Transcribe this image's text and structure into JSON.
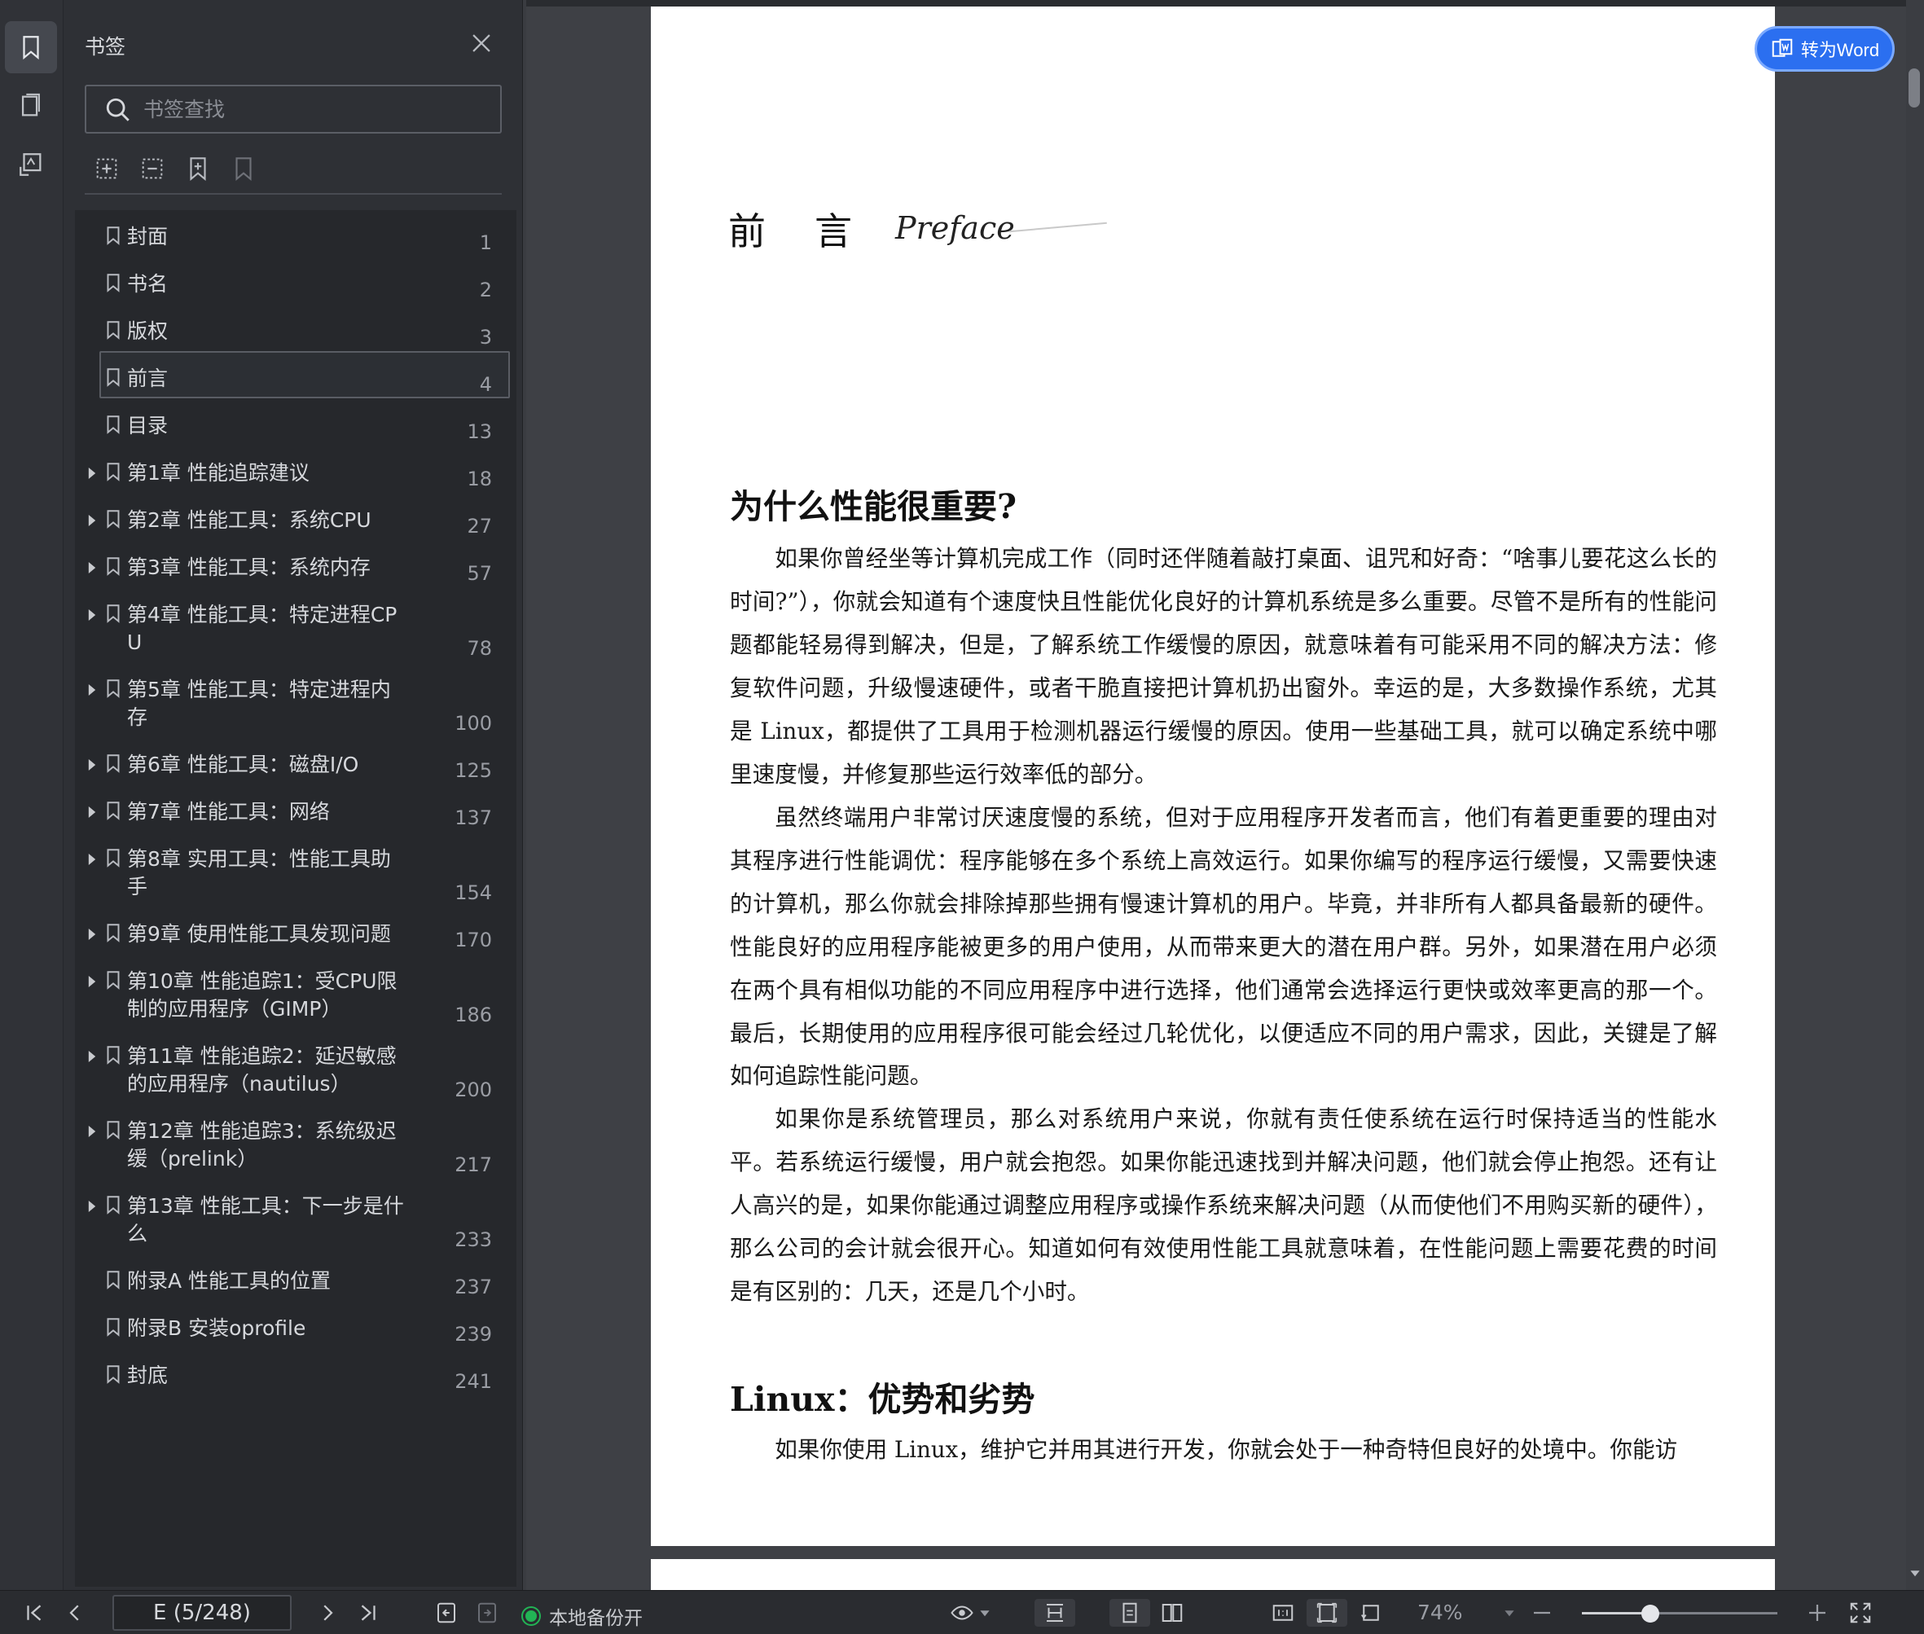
{
  "sidebar_panel": {
    "title": "书签",
    "search_placeholder": "书签查找"
  },
  "bookmarks": [
    {
      "label": "封面",
      "page": "1",
      "expandable": false
    },
    {
      "label": "书名",
      "page": "2",
      "expandable": false
    },
    {
      "label": "版权",
      "page": "3",
      "expandable": false
    },
    {
      "label": "前言",
      "page": "4",
      "expandable": false,
      "selected": true
    },
    {
      "label": "目录",
      "page": "13",
      "expandable": false
    },
    {
      "label": "第1章  性能追踪建议",
      "page": "18",
      "expandable": true
    },
    {
      "label": "第2章  性能工具：系统CPU",
      "page": "27",
      "expandable": true
    },
    {
      "label": "第3章  性能工具：系统内存",
      "page": "57",
      "expandable": true
    },
    {
      "label": "第4章  性能工具：特定进程CP\nU",
      "page": "78",
      "expandable": true
    },
    {
      "label": "第5章  性能工具：特定进程内\n存",
      "page": "100",
      "expandable": true
    },
    {
      "label": "第6章  性能工具：磁盘I/O",
      "page": "125",
      "expandable": true
    },
    {
      "label": "第7章  性能工具：网络",
      "page": "137",
      "expandable": true
    },
    {
      "label": "第8章  实用工具：性能工具助\n手",
      "page": "154",
      "expandable": true
    },
    {
      "label": "第9章  使用性能工具发现问题",
      "page": "170",
      "expandable": true
    },
    {
      "label": "第10章  性能追踪1：受CPU限\n制的应用程序（GIMP）",
      "page": "186",
      "expandable": true
    },
    {
      "label": "第11章  性能追踪2：延迟敏感\n的应用程序（nautilus）",
      "page": "200",
      "expandable": true
    },
    {
      "label": "第12章  性能追踪3：系统级迟\n缓（prelink）",
      "page": "217",
      "expandable": true
    },
    {
      "label": "第13章  性能工具：下一步是什\n么",
      "page": "233",
      "expandable": true
    },
    {
      "label": "附录A  性能工具的位置",
      "page": "237",
      "expandable": false
    },
    {
      "label": "附录B  安装oprofile",
      "page": "239",
      "expandable": false
    },
    {
      "label": "封底",
      "page": "241",
      "expandable": false
    }
  ],
  "document": {
    "preface_title": "前言",
    "preface_script": "Preface",
    "section1_heading": "为什么性能很重要?",
    "section1_p1": "如果你曾经坐等计算机完成工作（同时还伴随着敲打桌面、诅咒和好奇：“啥事儿要花这么长的时间?”），你就会知道有个速度快且性能优化良好的计算机系统是多么重要。尽管不是所有的性能问题都能轻易得到解决，但是，了解系统工作缓慢的原因，就意味着有可能采用不同的解决方法：修复软件问题，升级慢速硬件，或者干脆直接把计算机扔出窗外。幸运的是，大多数操作系统，尤其是 Linux，都提供了工具用于检测机器运行缓慢的原因。使用一些基础工具，就可以确定系统中哪里速度慢，并修复那些运行效率低的部分。",
    "section1_p2": "虽然终端用户非常讨厌速度慢的系统，但对于应用程序开发者而言，他们有着更重要的理由对其程序进行性能调优：程序能够在多个系统上高效运行。如果你编写的程序运行缓慢，又需要快速的计算机，那么你就会排除掉那些拥有慢速计算机的用户。毕竟，并非所有人都具备最新的硬件。性能良好的应用程序能被更多的用户使用，从而带来更大的潜在用户群。另外，如果潜在用户必须在两个具有相似功能的不同应用程序中进行选择，他们通常会选择运行更快或效率更高的那一个。最后，长期使用的应用程序很可能会经过几轮优化，以便适应不同的用户需求，因此，关键是了解如何追踪性能问题。",
    "section1_p3": "如果你是系统管理员，那么对系统用户来说，你就有责任使系统在运行时保持适当的性能水平。若系统运行缓慢，用户就会抱怨。如果你能迅速找到并解决问题，他们就会停止抱怨。还有让人高兴的是，如果你能通过调整应用程序或操作系统来解决问题（从而使他们不用购买新的硬件），那么公司的会计就会很开心。知道如何有效使用性能工具就意味着，在性能问题上需要花费的时间是有区别的：几天，还是几个小时。",
    "section2_heading": "Linux：优势和劣势",
    "section2_p1": "如果你使用 Linux，维护它并用其进行开发，你就会处于一种奇特但良好的处境中。你能访"
  },
  "convert_button": {
    "label": "转为Word"
  },
  "statusbar": {
    "page_indicator": "E (5/248)",
    "backup_label": "本地备份开",
    "zoom": "74%",
    "zoom_fraction": 0.35
  },
  "colors": {
    "accent": "#2b6ff0",
    "backup_status": "#22b455"
  }
}
